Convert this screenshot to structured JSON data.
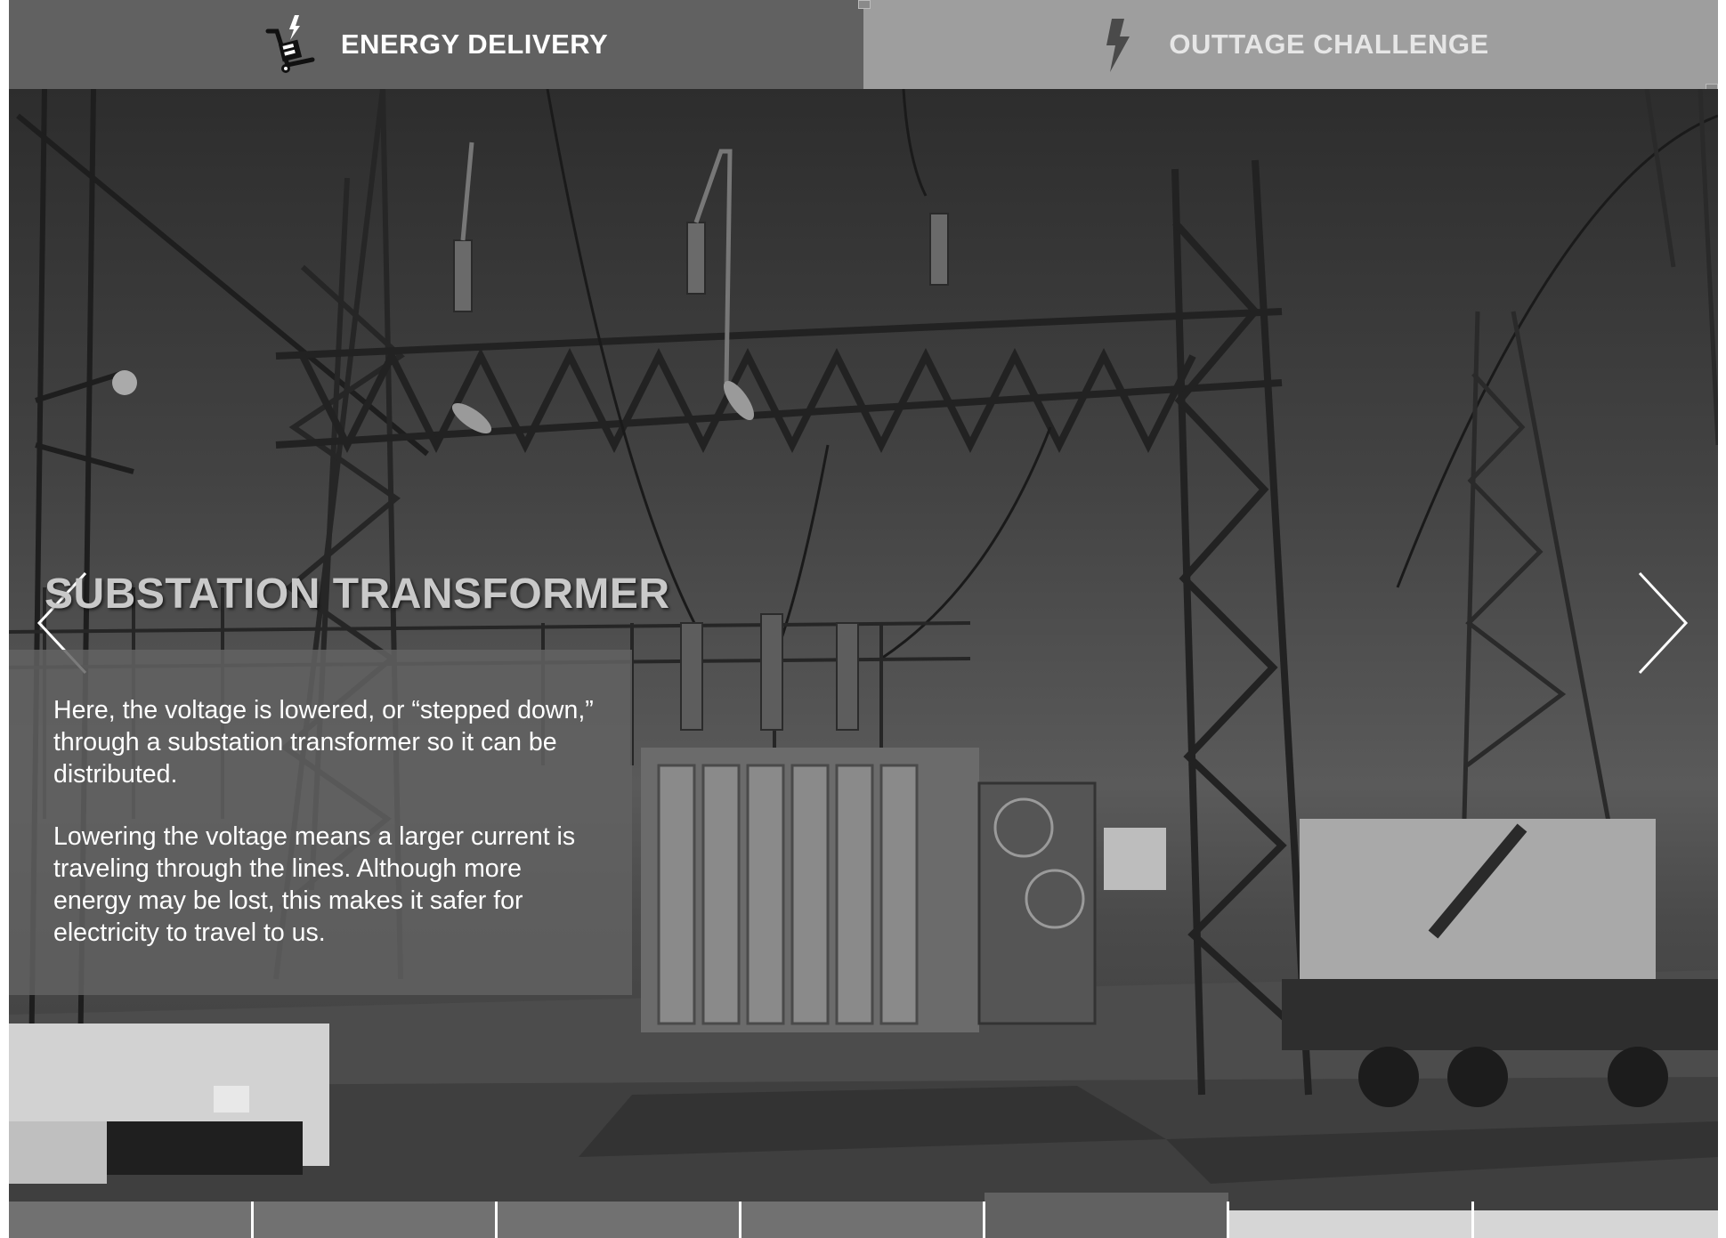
{
  "tabs": [
    {
      "label": "ENERGY DELIVERY",
      "icon": "hand-truck-lightning-icon",
      "active": true
    },
    {
      "label": "OUTTAGE CHALLENGE",
      "icon": "lightning-bolt-icon",
      "active": false
    }
  ],
  "slide": {
    "title": "SUBSTATION TRANSFORMER",
    "paragraphs": [
      "Here, the voltage is lowered, or “stepped down,” through a substation transformer so it can be distributed.",
      "Lowering the voltage means a larger current is traveling through the lines. Although more energy may be lost, this makes it safer for electricity to travel to us."
    ],
    "image": "substation-transformer-photo"
  },
  "navigation": {
    "prev_icon": "chevron-left-icon",
    "next_icon": "chevron-right-icon"
  },
  "progress": {
    "total_steps": 7,
    "current_step": 5
  },
  "colors": {
    "active_tab": "#616161",
    "inactive_tab": "#9e9e9e",
    "panel": "#626262",
    "progress_done": "#717171",
    "progress_todo": "#d6d6d6"
  }
}
